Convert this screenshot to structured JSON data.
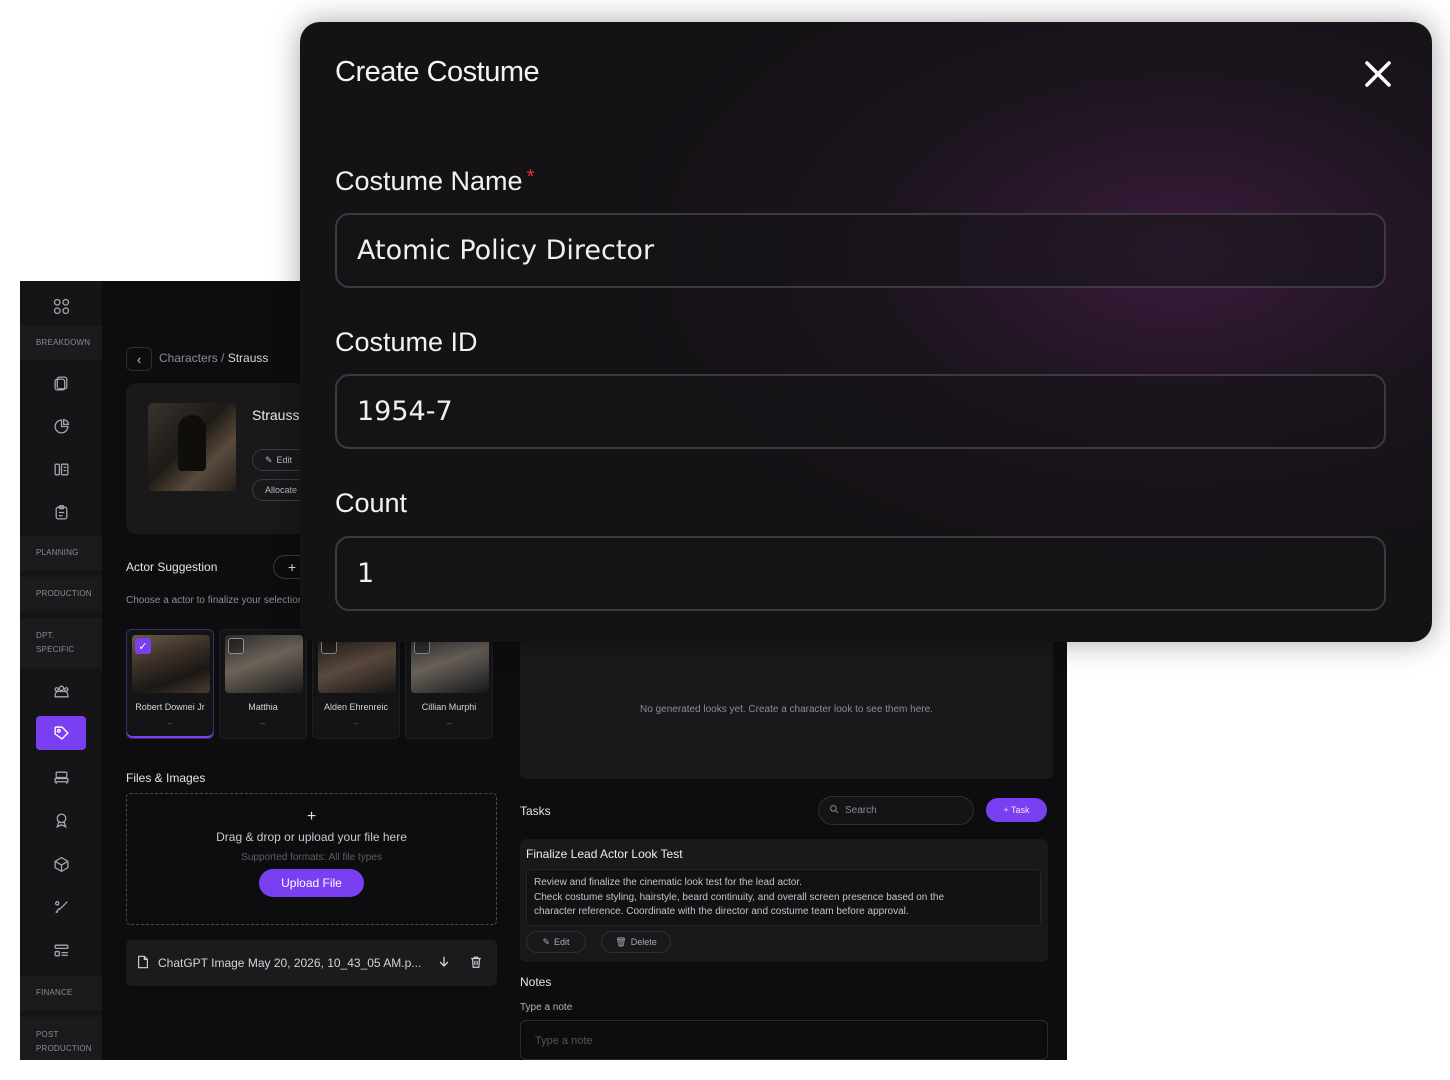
{
  "sidebar": {
    "sections": [
      "BREAKDOWN",
      "PLANNING",
      "PRODUCTION",
      "DPT. SPECIFIC",
      "FINANCE",
      "POST PRODUCTION"
    ],
    "icons": [
      "grid-icon",
      "copy-icon",
      "pie-chart-icon",
      "columns-icon",
      "clipboard-icon",
      "team-icon",
      "tag-icon",
      "chair-icon",
      "medal-icon",
      "cube-icon",
      "brush-icon",
      "list-icon"
    ],
    "active_icon": "tag-icon",
    "accent": "#7b3ff2"
  },
  "breadcrumb": {
    "parent": "Characters",
    "separator": " / ",
    "current": "Strauss"
  },
  "character": {
    "name": "Strauss",
    "edit_label": "Edit",
    "allocate_label": "Allocate"
  },
  "actor_suggestion": {
    "title": "Actor Suggestion",
    "add_label": "+",
    "subtitle": "Choose a actor to finalize your selection",
    "actors": [
      {
        "name": "Robert Downei Jr",
        "detail": "–",
        "selected": true
      },
      {
        "name": "Matthia",
        "detail": "–",
        "selected": false
      },
      {
        "name": "Alden Ehrenreic",
        "detail": "–",
        "selected": false
      },
      {
        "name": "Cillian Murphi",
        "detail": "–",
        "selected": false
      }
    ]
  },
  "files": {
    "title": "Files & Images",
    "dropzone_plus": "+",
    "dropzone_title": "Drag & drop or upload your file here",
    "dropzone_sub": "Supported formats: All file types",
    "upload_label": "Upload File",
    "file_name": "ChatGPT Image May 20, 2026, 10_43_05 AM.p..."
  },
  "looks": {
    "empty_text": "No generated looks yet. Create a character look to see them here."
  },
  "tasks": {
    "title": "Tasks",
    "search_placeholder": "Search",
    "add_label": "+ Task",
    "items": [
      {
        "title": "Finalize Lead Actor Look Test",
        "description_lines": [
          "Review and finalize the cinematic look test for the lead actor.",
          "Check costume styling, hairstyle, beard continuity, and overall screen presence based on the",
          "character reference. Coordinate with the director and costume team before approval."
        ],
        "edit_label": "Edit",
        "delete_label": "Delete"
      }
    ]
  },
  "notes": {
    "title": "Notes",
    "label": "Type a note",
    "placeholder": "Type a note"
  },
  "modal": {
    "title": "Create Costume",
    "close_icon": "close-icon",
    "fields": [
      {
        "label": "Costume Name",
        "required": true,
        "value": "Atomic Policy Director"
      },
      {
        "label": "Costume ID",
        "required": false,
        "value": "1954-7"
      },
      {
        "label": "Count",
        "required": false,
        "value": "1"
      }
    ],
    "required_mark": "*"
  }
}
